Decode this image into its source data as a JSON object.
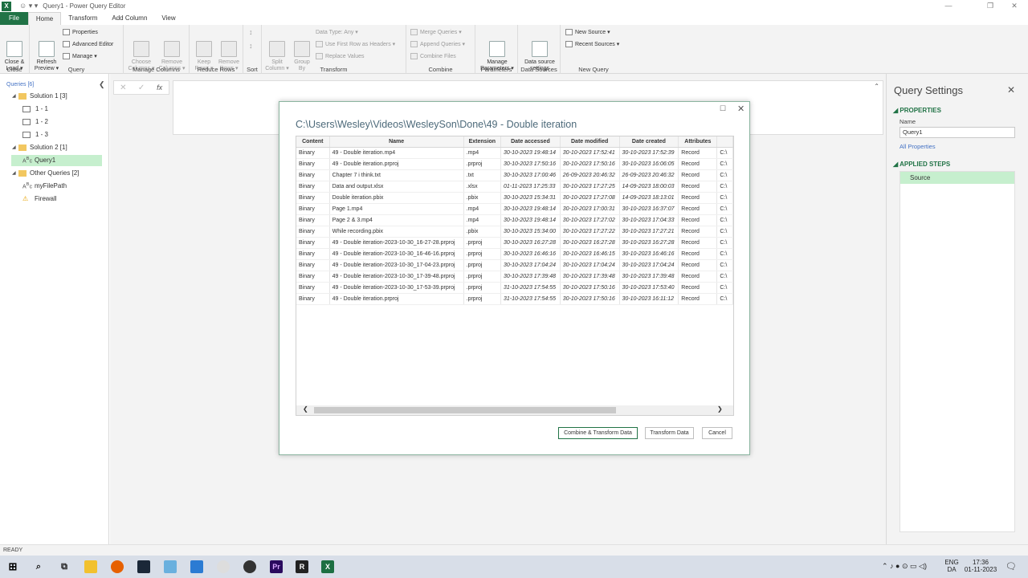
{
  "window": {
    "title": "Query1 - Power Query Editor",
    "app_icon": "X",
    "quick_access": "☺ ▾ ▾"
  },
  "ribbon_tabs": [
    "File",
    "Home",
    "Transform",
    "Add Column",
    "View"
  ],
  "ribbon": {
    "close": {
      "label": "Close &\nLoad ▾",
      "group": "Close"
    },
    "query": {
      "refresh": "Refresh\nPreview ▾",
      "properties": "Properties",
      "advanced_editor": "Advanced Editor",
      "manage": "Manage ▾",
      "group": "Query"
    },
    "manage_columns": {
      "choose": "Choose\nColumns ▾",
      "remove": "Remove\nColumns ▾",
      "group": "Manage Columns"
    },
    "reduce_rows": {
      "keep": "Keep\nRows ▾",
      "remove": "Remove\nRows ▾",
      "group": "Reduce Rows"
    },
    "sort": {
      "group": "Sort"
    },
    "transform": {
      "split": "Split\nColumn ▾",
      "group_by": "Group\nBy",
      "data_type": "Data Type: Any ▾",
      "first_row": "Use First Row as Headers ▾",
      "replace": "Replace Values",
      "group": "Transform"
    },
    "combine": {
      "merge": "Merge Queries ▾",
      "append": "Append Queries ▾",
      "combine_files": "Combine Files",
      "group": "Combine"
    },
    "parameters": {
      "manage": "Manage\nParameters ▾",
      "group": "Parameters"
    },
    "data_sources": {
      "settings": "Data source\nsettings",
      "group": "Data Sources"
    },
    "new_query": {
      "new_source": "New Source ▾",
      "recent_sources": "Recent Sources ▾",
      "group": "New Query"
    }
  },
  "queries_pane": {
    "header": "Queries [6]",
    "items": [
      {
        "label": "Solution 1 [3]",
        "kind": "folder"
      },
      {
        "label": "1 - 1",
        "kind": "table"
      },
      {
        "label": "1 - 2",
        "kind": "table"
      },
      {
        "label": "1 - 3",
        "kind": "table"
      },
      {
        "label": "Solution 2 [1]",
        "kind": "folder"
      },
      {
        "label": "Query1",
        "kind": "abc"
      },
      {
        "label": "Other Queries [2]",
        "kind": "folder"
      },
      {
        "label": "myFilePath",
        "kind": "abc"
      },
      {
        "label": "Firewall",
        "kind": "warning"
      }
    ]
  },
  "formula_bar": {
    "cancel": "✕",
    "confirm": "✓",
    "fx": "fx"
  },
  "query_settings": {
    "title": "Query Settings",
    "properties_header": "PROPERTIES",
    "name_label": "Name",
    "name_value": "Query1",
    "all_properties": "All Properties",
    "applied_steps_header": "APPLIED STEPS",
    "steps": [
      "Source"
    ]
  },
  "dialog": {
    "path": "C:\\Users\\Wesley\\Videos\\WesleySon\\Done\\49 - Double iteration",
    "columns": [
      "Content",
      "Name",
      "Extension",
      "Date accessed",
      "Date modified",
      "Date created",
      "Attributes",
      ""
    ],
    "rows": [
      [
        "Binary",
        "49 - Double iteration.mp4",
        ".mp4",
        "30-10-2023 19:48:14",
        "30-10-2023 17:52:41",
        "30-10-2023 17:52:39",
        "Record",
        "C:\\"
      ],
      [
        "Binary",
        "49 - Double iteration.prproj",
        ".prproj",
        "30-10-2023 17:50:16",
        "30-10-2023 17:50:16",
        "30-10-2023 16:06:05",
        "Record",
        "C:\\"
      ],
      [
        "Binary",
        "Chapter 7 i think.txt",
        ".txt",
        "30-10-2023 17:00:46",
        "26-09-2023 20:46:32",
        "26-09-2023 20:46:32",
        "Record",
        "C:\\"
      ],
      [
        "Binary",
        "Data and output.xlsx",
        ".xlsx",
        "01-11-2023 17:25:33",
        "30-10-2023 17:27:25",
        "14-09-2023 18:00:03",
        "Record",
        "C:\\"
      ],
      [
        "Binary",
        "Double iteration.pbix",
        ".pbix",
        "30-10-2023 15:34:31",
        "30-10-2023 17:27:08",
        "14-09-2023 18:13:01",
        "Record",
        "C:\\"
      ],
      [
        "Binary",
        "Page 1.mp4",
        ".mp4",
        "30-10-2023 19:48:14",
        "30-10-2023 17:00:31",
        "30-10-2023 16:37:07",
        "Record",
        "C:\\"
      ],
      [
        "Binary",
        "Page 2 & 3.mp4",
        ".mp4",
        "30-10-2023 19:48:14",
        "30-10-2023 17:27:02",
        "30-10-2023 17:04:33",
        "Record",
        "C:\\"
      ],
      [
        "Binary",
        "While recording.pbix",
        ".pbix",
        "30-10-2023 15:34:00",
        "30-10-2023 17:27:22",
        "30-10-2023 17:27:21",
        "Record",
        "C:\\"
      ],
      [
        "Binary",
        "49 - Double iteration-2023-10-30_16-27-28.prproj",
        ".prproj",
        "30-10-2023 16:27:28",
        "30-10-2023 16:27:28",
        "30-10-2023 16:27:28",
        "Record",
        "C:\\"
      ],
      [
        "Binary",
        "49 - Double iteration-2023-10-30_16-46-16.prproj",
        ".prproj",
        "30-10-2023 16:46:16",
        "30-10-2023 16:46:15",
        "30-10-2023 16:46:16",
        "Record",
        "C:\\"
      ],
      [
        "Binary",
        "49 - Double iteration-2023-10-30_17-04-23.prproj",
        ".prproj",
        "30-10-2023 17:04:24",
        "30-10-2023 17:04:24",
        "30-10-2023 17:04:24",
        "Record",
        "C:\\"
      ],
      [
        "Binary",
        "49 - Double iteration-2023-10-30_17-39-48.prproj",
        ".prproj",
        "30-10-2023 17:39:48",
        "30-10-2023 17:39:48",
        "30-10-2023 17:39:48",
        "Record",
        "C:\\"
      ],
      [
        "Binary",
        "49 - Double iteration-2023-10-30_17-53-39.prproj",
        ".prproj",
        "31-10-2023 17:54:55",
        "30-10-2023 17:50:16",
        "30-10-2023 17:53:40",
        "Record",
        "C:\\"
      ],
      [
        "Binary",
        "49 - Double iteration.prproj",
        ".prproj",
        "31-10-2023 17:54:55",
        "30-10-2023 17:50:16",
        "30-10-2023 16:11:12",
        "Record",
        "C:\\"
      ]
    ],
    "buttons": {
      "combine": "Combine & Transform Data",
      "transform": "Transform Data",
      "cancel": "Cancel"
    }
  },
  "status_bar": "READY",
  "taskbar": {
    "lang": "ENG",
    "region": "DA",
    "time": "17:36",
    "date": "01-11-2023"
  },
  "colors": {
    "accent": "#217346",
    "selection": "#c6efce",
    "link": "#4472c4"
  }
}
